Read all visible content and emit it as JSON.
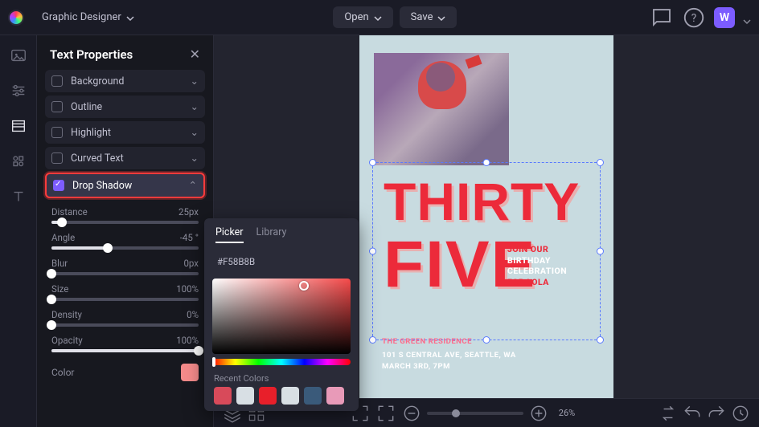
{
  "topbar": {
    "mode": "Graphic Designer",
    "open": "Open",
    "save": "Save",
    "avatar": "W"
  },
  "panel": {
    "title": "Text Properties",
    "sections": {
      "background": "Background",
      "outline": "Outline",
      "highlight": "Highlight",
      "curved": "Curved Text",
      "dropshadow": "Drop Shadow"
    },
    "sliders": {
      "distance": {
        "label": "Distance",
        "value": "25px",
        "pct": 7
      },
      "angle": {
        "label": "Angle",
        "value": "-45 °",
        "pct": 38
      },
      "blur": {
        "label": "Blur",
        "value": "0px",
        "pct": 0
      },
      "size": {
        "label": "Size",
        "value": "100%",
        "pct": 0
      },
      "density": {
        "label": "Density",
        "value": "0%",
        "pct": 0
      },
      "opacity": {
        "label": "Opacity",
        "value": "100%",
        "pct": 100
      }
    },
    "color_label": "Color",
    "suffix_px": "px"
  },
  "picker": {
    "tabs": {
      "picker": "Picker",
      "library": "Library"
    },
    "hex": "#F58B8B",
    "recent_label": "Recent Colors",
    "recent": [
      "#d84a5a",
      "#d8dfe4",
      "#e81f2a",
      "#d8dfe4",
      "#3a5a7a",
      "#e89ab8"
    ]
  },
  "canvas": {
    "line1": "THIRTY",
    "line2": "FIVE",
    "cta1": "JOIN OUR",
    "cta2": "BIRTHDAY",
    "cta3": "CELEBRATION",
    "cta4": "FOR LOLA",
    "venue": "THE GREEN RESIDENCE",
    "addr1": "101 S CENTRAL AVE, SEATTLE, WA",
    "addr2": "MARCH 3RD, 7PM"
  },
  "bottombar": {
    "zoom": "26%"
  }
}
